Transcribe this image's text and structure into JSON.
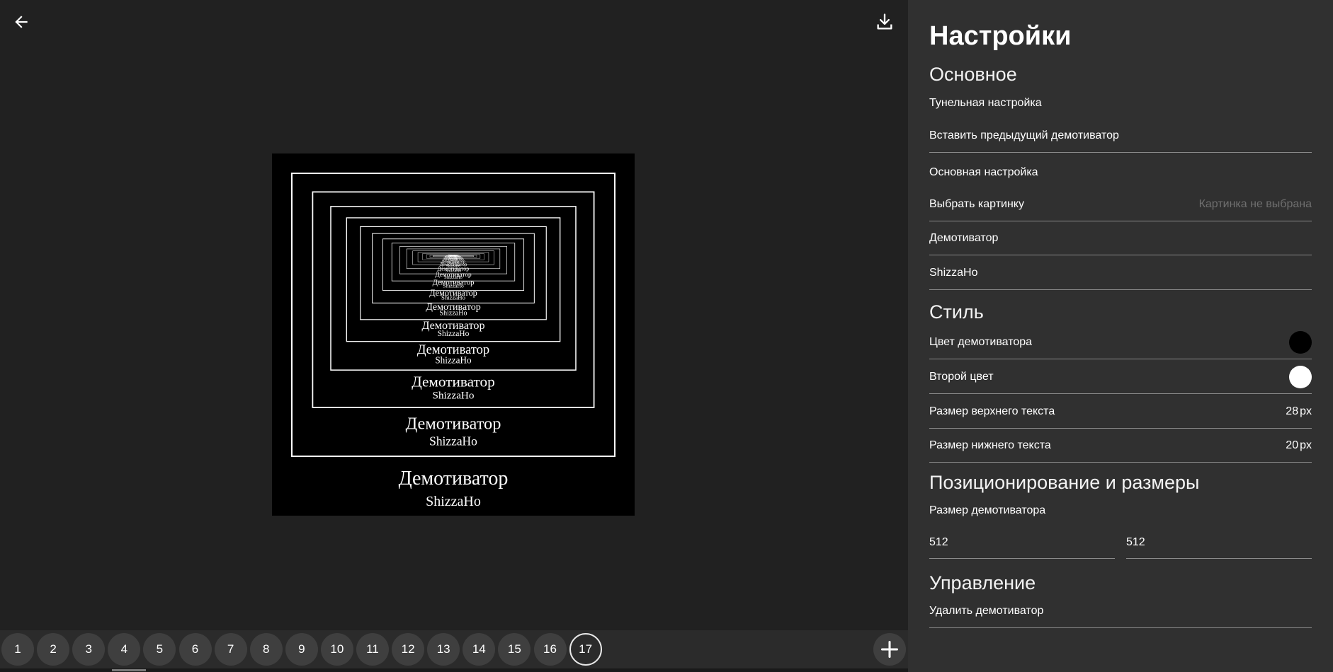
{
  "preview": {
    "caption_top": "Демотиватор",
    "caption_bottom": "ShizzaHo",
    "border_color": "#ffffff",
    "background": "#000000"
  },
  "bottombar": {
    "tabs": [
      "1",
      "2",
      "3",
      "4",
      "5",
      "6",
      "7",
      "8",
      "9",
      "10",
      "11",
      "12",
      "13",
      "14",
      "15",
      "16",
      "17"
    ],
    "active_tab": "17"
  },
  "settings": {
    "title": "Настройки",
    "sections": {
      "main": "Основное",
      "style": "Стиль",
      "positioning": "Позиционирование и размеры",
      "control": "Управление"
    },
    "tunnel_label": "Тунельная настройка",
    "insert_prev": "Вставить предыдущий демотиватор",
    "basic_label": "Основная настройка",
    "choose_image": "Выбрать картинку",
    "choose_image_placeholder": "Картинка не выбрана",
    "top_text": "Демотиватор",
    "bottom_text": "ShizzaHo",
    "demot_color_label": "Цвет демотиватора",
    "demot_color": "#000000",
    "second_color_label": "Второй цвет",
    "second_color": "#ffffff",
    "top_size_label": "Размер верхнего текста",
    "top_size_value": "28",
    "bottom_size_label": "Размер нижнего текста",
    "bottom_size_value": "20",
    "unit": "px",
    "size_label": "Размер демотиватора",
    "width": "512",
    "height": "512",
    "delete": "Удалить демотиватор"
  }
}
